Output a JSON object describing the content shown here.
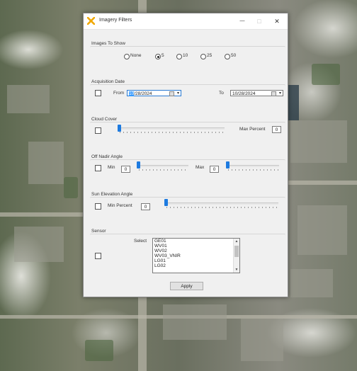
{
  "window": {
    "title": "Imagery Filters",
    "minimize": "—",
    "maximize": "□",
    "close": "✕"
  },
  "images_to_show": {
    "label": "Images To Show",
    "options": [
      "None",
      "5",
      "10",
      "25",
      "50"
    ],
    "selected": "5"
  },
  "acquisition_date": {
    "label": "Acquisition Date",
    "from_label": "From",
    "from_value_selected": "10",
    "from_value_rest": "/28/2024",
    "to_label": "To",
    "to_value": "10/28/2024"
  },
  "cloud_cover": {
    "label": "Cloud Cover",
    "max_label": "Max Percent",
    "max_value": "0"
  },
  "off_nadir": {
    "label": "Off Nadir Angle",
    "min_label": "Min",
    "min_value": "0",
    "max_label": "Max",
    "max_value": "0"
  },
  "sun_elevation": {
    "label": "Sun Elevation Angle",
    "min_label": "Min Percent",
    "min_value": "0"
  },
  "sensor": {
    "label": "Sensor",
    "select_label": "Select",
    "items": [
      "GE01",
      "WV01",
      "WV02",
      "WV03_VNIR",
      "LG01",
      "LG02"
    ]
  },
  "apply_label": "Apply",
  "icons": {
    "app": "yellow-x-icon",
    "calendar": "calendar-icon",
    "dropdown": "chevron-down-icon"
  },
  "colors": {
    "accent": "#1e7be0",
    "selection": "#3399ff",
    "app_icon": "#f0a800"
  }
}
